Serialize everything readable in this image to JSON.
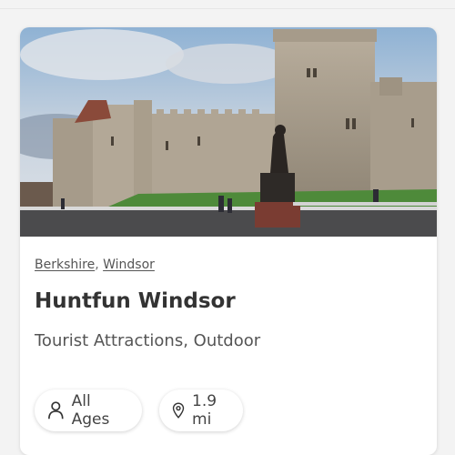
{
  "breadcrumb": {
    "county": "Berkshire",
    "separator": ",",
    "town": "Windsor"
  },
  "listing": {
    "title": "Huntfun Windsor",
    "categories": "Tourist Attractions, Outdoor"
  },
  "chips": {
    "ages": {
      "label": "All Ages",
      "icon": "person-icon"
    },
    "distance": {
      "label": "1.9 mi",
      "icon": "location-pin-icon"
    }
  },
  "colors": {
    "card_bg": "#ffffff",
    "title": "#333333",
    "text": "#555555"
  }
}
